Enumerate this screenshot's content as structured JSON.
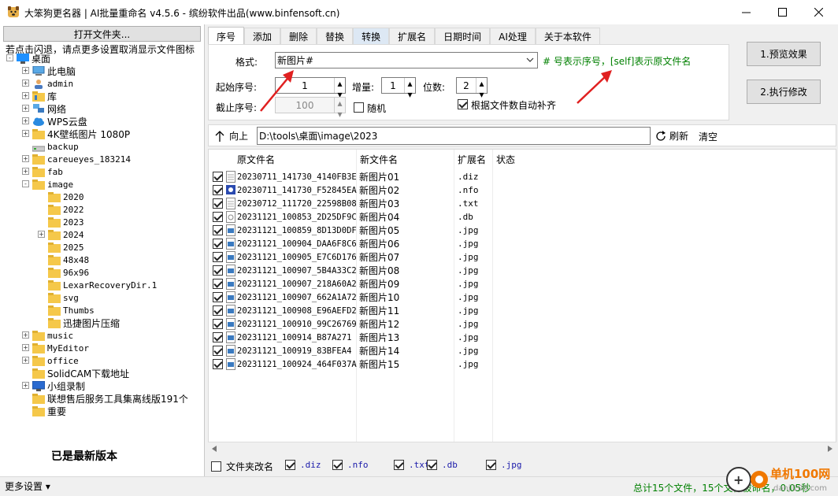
{
  "window": {
    "title": "大笨狗更名器 | AI批量重命名 v4.5.6 - 缤纷软件出品(www.binfensoft.cn)"
  },
  "left": {
    "open_folder": "打开文件夹...",
    "hint": "若点击闪退，请点更多设置取消显示文件图标",
    "tree": [
      {
        "label": "桌面",
        "level": 0,
        "icon": "desktop-icon",
        "exp": "-"
      },
      {
        "label": "此电脑",
        "level": 1,
        "icon": "computer-icon",
        "exp": "+"
      },
      {
        "label": "admin",
        "level": 1,
        "icon": "user-folder-icon",
        "exp": "+"
      },
      {
        "label": "库",
        "level": 1,
        "icon": "library-icon",
        "exp": "+"
      },
      {
        "label": "网络",
        "level": 1,
        "icon": "network-icon",
        "exp": "+"
      },
      {
        "label": "WPS云盘",
        "level": 1,
        "icon": "cloud-icon",
        "exp": "+"
      },
      {
        "label": "4K壁纸图片 1080P",
        "level": 1,
        "icon": "folder-icon",
        "exp": "+"
      },
      {
        "label": "backup",
        "level": 1,
        "icon": "drive-folder-icon",
        "exp": ""
      },
      {
        "label": "careueyes_183214",
        "level": 1,
        "icon": "folder-icon",
        "exp": "+"
      },
      {
        "label": "fab",
        "level": 1,
        "icon": "folder-icon",
        "exp": "+"
      },
      {
        "label": "image",
        "level": 1,
        "icon": "folder-icon",
        "exp": "-"
      },
      {
        "label": "2020",
        "level": 2,
        "icon": "folder-icon",
        "exp": ""
      },
      {
        "label": "2022",
        "level": 2,
        "icon": "folder-icon",
        "exp": ""
      },
      {
        "label": "2023",
        "level": 2,
        "icon": "folder-icon",
        "exp": ""
      },
      {
        "label": "2024",
        "level": 2,
        "icon": "folder-icon",
        "exp": "+"
      },
      {
        "label": "2025",
        "level": 2,
        "icon": "folder-icon",
        "exp": ""
      },
      {
        "label": "48x48",
        "level": 2,
        "icon": "folder-icon",
        "exp": ""
      },
      {
        "label": "96x96",
        "level": 2,
        "icon": "folder-icon",
        "exp": ""
      },
      {
        "label": "LexarRecoveryDir.1",
        "level": 2,
        "icon": "folder-icon",
        "exp": ""
      },
      {
        "label": "svg",
        "level": 2,
        "icon": "folder-icon",
        "exp": ""
      },
      {
        "label": "Thumbs",
        "level": 2,
        "icon": "folder-icon",
        "exp": ""
      },
      {
        "label": "迅捷图片压缩",
        "level": 2,
        "icon": "folder-icon",
        "exp": ""
      },
      {
        "label": "music",
        "level": 1,
        "icon": "folder-icon",
        "exp": "+"
      },
      {
        "label": "MyEditor",
        "level": 1,
        "icon": "folder-icon",
        "exp": "+"
      },
      {
        "label": "office",
        "level": 1,
        "icon": "folder-icon",
        "exp": "+"
      },
      {
        "label": "SolidCAM下载地址",
        "level": 1,
        "icon": "folder-icon",
        "exp": ""
      },
      {
        "label": "小组录制",
        "level": 1,
        "icon": "monitor-icon",
        "exp": "+"
      },
      {
        "label": "联想售后服务工具集离线版191个",
        "level": 1,
        "icon": "folder-icon",
        "exp": ""
      },
      {
        "label": "重要",
        "level": 1,
        "icon": "folder-icon",
        "exp": ""
      }
    ],
    "latest": "已是最新版本",
    "more_settings": "更多设置 ▾"
  },
  "tabs": [
    "序号",
    "添加",
    "删除",
    "替换",
    "转换",
    "扩展名",
    "日期时间",
    "AI处理",
    "关于本软件"
  ],
  "seq": {
    "format_label": "格式:",
    "format_value": "新图片#",
    "format_hint": "# 号表示序号，[self]表示原文件名",
    "start_label": "起始序号:",
    "start_value": "1",
    "inc_label": "增量:",
    "inc_value": "1",
    "digits_label": "位数:",
    "digits_value": "2",
    "end_label": "截止序号:",
    "end_value": "100",
    "random_label": "随机",
    "autopad_label": "根据文件数自动补齐"
  },
  "actions": {
    "preview": "1.预览效果",
    "execute": "2.执行修改"
  },
  "pathbar": {
    "up": "向上",
    "path": "D:\\tools\\桌面\\image\\2023",
    "refresh": "刷新",
    "clear": "清空"
  },
  "list": {
    "headers": [
      "原文件名",
      "新文件名",
      "扩展名",
      "状态"
    ],
    "rows": [
      {
        "orig": "20230711_141730_4140FB3E",
        "new": "新图片01",
        "ext": ".diz",
        "icon": "text-file-icon"
      },
      {
        "orig": "20230711_141730_F52845EA",
        "new": "新图片02",
        "ext": ".nfo",
        "icon": "info-file-icon"
      },
      {
        "orig": "20230712_111720_22598B08",
        "new": "新图片03",
        "ext": ".txt",
        "icon": "text-file-icon"
      },
      {
        "orig": "20231121_100853_2D25DF9C",
        "new": "新图片04",
        "ext": ".db",
        "icon": "db-file-icon"
      },
      {
        "orig": "20231121_100859_8D13D0DF",
        "new": "新图片05",
        "ext": ".jpg",
        "icon": "image-file-icon"
      },
      {
        "orig": "20231121_100904_DAA6F8C6",
        "new": "新图片06",
        "ext": ".jpg",
        "icon": "image-file-icon"
      },
      {
        "orig": "20231121_100905_E7C6D176",
        "new": "新图片07",
        "ext": ".jpg",
        "icon": "image-file-icon"
      },
      {
        "orig": "20231121_100907_5B4A33C2",
        "new": "新图片08",
        "ext": ".jpg",
        "icon": "image-file-icon"
      },
      {
        "orig": "20231121_100907_218A60A2",
        "new": "新图片09",
        "ext": ".jpg",
        "icon": "image-file-icon"
      },
      {
        "orig": "20231121_100907_662A1A72",
        "new": "新图片10",
        "ext": ".jpg",
        "icon": "image-file-icon"
      },
      {
        "orig": "20231121_100908_E96AEFD2",
        "new": "新图片11",
        "ext": ".jpg",
        "icon": "image-file-icon"
      },
      {
        "orig": "20231121_100910_99C26769",
        "new": "新图片12",
        "ext": ".jpg",
        "icon": "image-file-icon"
      },
      {
        "orig": "20231121_100914_B87A271",
        "new": "新图片13",
        "ext": ".jpg",
        "icon": "image-file-icon"
      },
      {
        "orig": "20231121_100919_83BFEA4",
        "new": "新图片14",
        "ext": ".jpg",
        "icon": "image-file-icon"
      },
      {
        "orig": "20231121_100924_464F037A",
        "new": "新图片15",
        "ext": ".jpg",
        "icon": "image-file-icon"
      }
    ]
  },
  "filters": {
    "folder_rename": "文件夹改名",
    "exts": [
      ".diz",
      ".nfo",
      ".txt",
      ".db",
      ".jpg"
    ]
  },
  "status": {
    "text": "总计15个文件，15个文件被命名，0.05秒"
  },
  "watermark": {
    "text": "单机100网",
    "url": "danji100.com"
  },
  "colors": {
    "green": "#008000",
    "arrow_red": "#e02020",
    "ext_blue": "#1a1aaa"
  }
}
